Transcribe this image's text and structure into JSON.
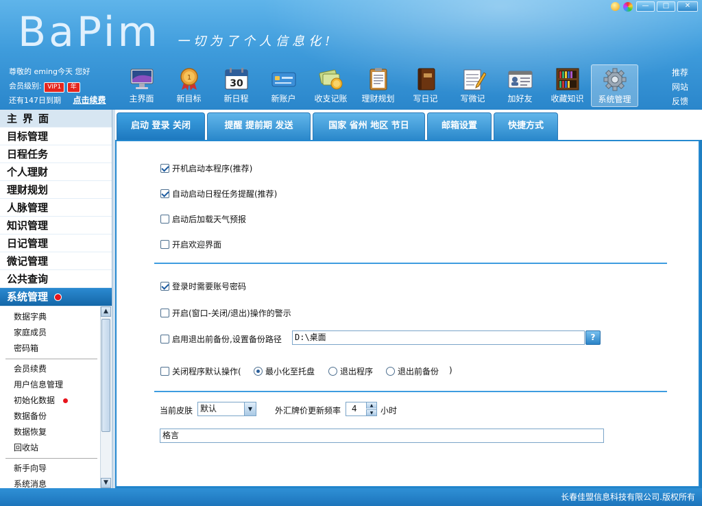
{
  "app": {
    "logo_text": "BaPim",
    "slogan": "一切为了个人信息化!"
  },
  "window_controls": {
    "minimize": "—",
    "maximize": "□",
    "close": "✕"
  },
  "user": {
    "greeting": "尊敬的 eming今天 您好",
    "level_label": "会员级别:",
    "vip_badge": "VIP1",
    "year_badge": "年",
    "expiry": "还有147日到期",
    "renew_link": "点击续费"
  },
  "toolbar": {
    "items": [
      {
        "label": "主界面",
        "icon": "monitor-icon"
      },
      {
        "label": "新目标",
        "icon": "medal-icon"
      },
      {
        "label": "新日程",
        "icon": "calendar-icon",
        "day": "30"
      },
      {
        "label": "新账户",
        "icon": "card-icon"
      },
      {
        "label": "收支记账",
        "icon": "money-icon"
      },
      {
        "label": "理财规划",
        "icon": "clipboard-icon"
      },
      {
        "label": "写日记",
        "icon": "diary-icon"
      },
      {
        "label": "写微记",
        "icon": "notepad-icon"
      },
      {
        "label": "加好友",
        "icon": "contact-card-icon"
      },
      {
        "label": "收藏知识",
        "icon": "bookshelf-icon"
      },
      {
        "label": "系统管理",
        "icon": "gear-icon"
      }
    ]
  },
  "side_links": [
    "推荐",
    "网站",
    "反馈"
  ],
  "nav": {
    "items": [
      "主界面",
      "目标管理",
      "日程任务",
      "个人理财",
      "理财规划",
      "人脉管理",
      "知识管理",
      "日记管理",
      "微记管理",
      "公共查询",
      "系统管理"
    ],
    "sub_items_1": [
      "数据字典",
      "家庭成员",
      "密码箱"
    ],
    "sub_items_2": [
      "会员续费",
      "用户信息管理",
      "初始化数据",
      "数据备份",
      "数据恢复",
      "回收站"
    ],
    "sub_items_3": [
      "新手向导",
      "系统消息"
    ]
  },
  "tabs": [
    "启动 登录 关闭",
    "提醒 提前期 发送",
    "国家 省州 地区 节日",
    "邮箱设置",
    "快捷方式"
  ],
  "settings": {
    "auto_start": "开机启动本程序(推荐)",
    "auto_reminder": "自动启动日程任务提醒(推荐)",
    "load_weather": "启动后加载天气预报",
    "welcome_screen": "开启欢迎界面",
    "login_password": "登录时需要账号密码",
    "window_warning": "开启(窗口-关闭/退出)操作的警示",
    "backup_before_exit": "启用退出前备份,设置备份路径",
    "backup_path": "D:\\桌面",
    "browse_label": "?",
    "close_default": "关闭程序默认操作(",
    "close_default_end": ")",
    "radio_minimize": "最小化至托盘",
    "radio_exit": "退出程序",
    "radio_backup_exit": "退出前备份",
    "skin_label": "当前皮肤",
    "skin_value": "默认",
    "fx_label": "外汇牌价更新频率",
    "fx_value": "4",
    "fx_unit": "小时",
    "motto": "格言"
  },
  "footer": {
    "copyright": "长春佳盟信息科技有限公司.版权所有"
  }
}
